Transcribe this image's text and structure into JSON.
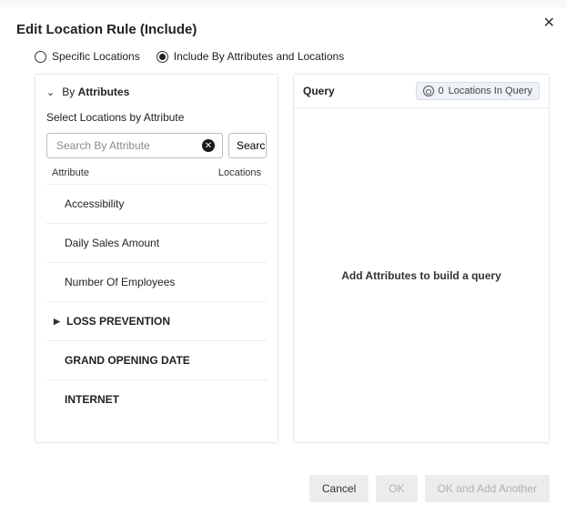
{
  "header": {
    "title": "Edit Location Rule (Include)"
  },
  "radios": {
    "specific": "Specific Locations",
    "by_attr": "Include By Attributes and Locations",
    "selected": "by_attr"
  },
  "left": {
    "section_prefix": "By",
    "section_bold": "Attributes",
    "subtitle": "Select Locations by Attribute",
    "search_placeholder": "Search By Attribute",
    "search_button": "Search",
    "col_attribute": "Attribute",
    "col_locations": "Locations",
    "rows": [
      {
        "label": "Accessibility",
        "group": false,
        "expandable": false
      },
      {
        "label": "Daily Sales Amount",
        "group": false,
        "expandable": false
      },
      {
        "label": "Number Of Employees",
        "group": false,
        "expandable": false
      },
      {
        "label": "LOSS PREVENTION",
        "group": true,
        "expandable": true
      },
      {
        "label": "GRAND OPENING DATE",
        "group": true,
        "expandable": false
      },
      {
        "label": "INTERNET",
        "group": true,
        "expandable": false
      }
    ]
  },
  "right": {
    "title": "Query",
    "chip_count": "0",
    "chip_suffix": "Locations In Query",
    "empty": "Add Attributes to build a query"
  },
  "footer": {
    "cancel": "Cancel",
    "ok": "OK",
    "ok_another": "OK and Add Another"
  }
}
